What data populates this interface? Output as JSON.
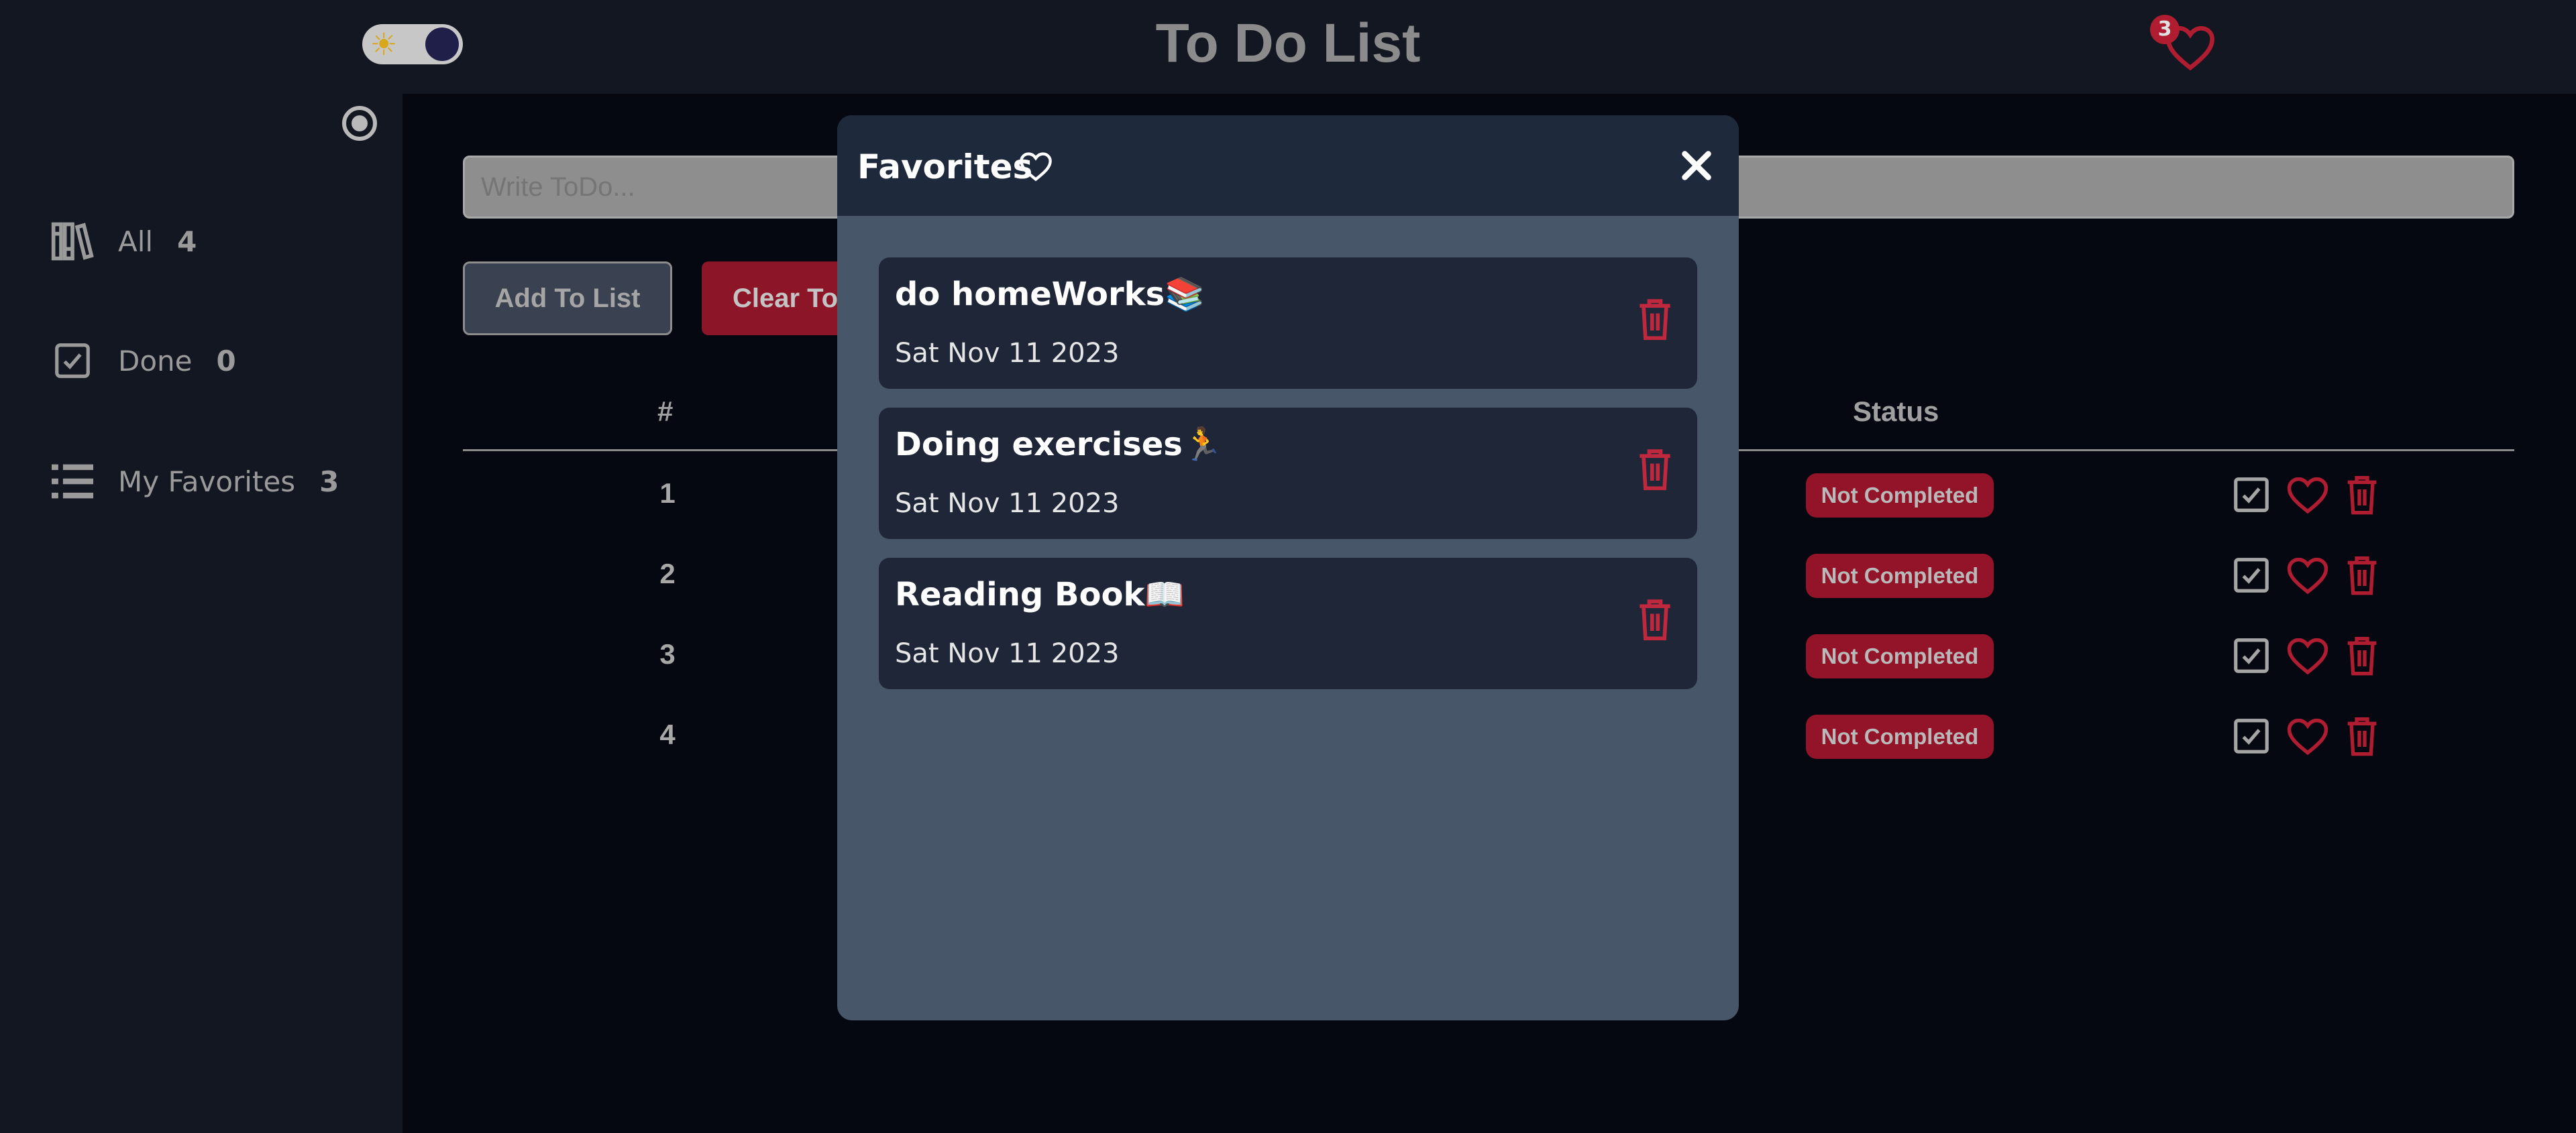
{
  "header": {
    "title": "To Do List",
    "theme_toggle_icon": "sun-icon",
    "favorites_count": "3"
  },
  "sidebar": {
    "items": [
      {
        "label": "All",
        "count": "4",
        "icon": "library-icon"
      },
      {
        "label": "Done",
        "count": "0",
        "icon": "checkbox-icon"
      },
      {
        "label": "My Favorites",
        "count": "3",
        "icon": "list-icon"
      }
    ]
  },
  "main": {
    "input_placeholder": "Write ToDo...",
    "add_label": "Add To List",
    "clear_label": "Clear To",
    "columns": {
      "number": "#",
      "status": "Status"
    },
    "rows": [
      {
        "num": "1",
        "status": "Not Completed"
      },
      {
        "num": "2",
        "status": "Not Completed"
      },
      {
        "num": "3",
        "status": "Not Completed"
      },
      {
        "num": "4",
        "status": "Not Completed"
      }
    ]
  },
  "modal": {
    "title": "Favorites",
    "items": [
      {
        "title": "do homeWorks📚",
        "date": "Sat Nov 11 2023"
      },
      {
        "title": "Doing exercises🏃",
        "date": "Sat Nov 11 2023"
      },
      {
        "title": "Reading Book📖",
        "date": "Sat Nov 11 2023"
      }
    ]
  },
  "colors": {
    "accent_red": "#b01c30",
    "modal_bg": "#485669",
    "card_bg": "#1e2638",
    "page_bg": "#050810"
  }
}
